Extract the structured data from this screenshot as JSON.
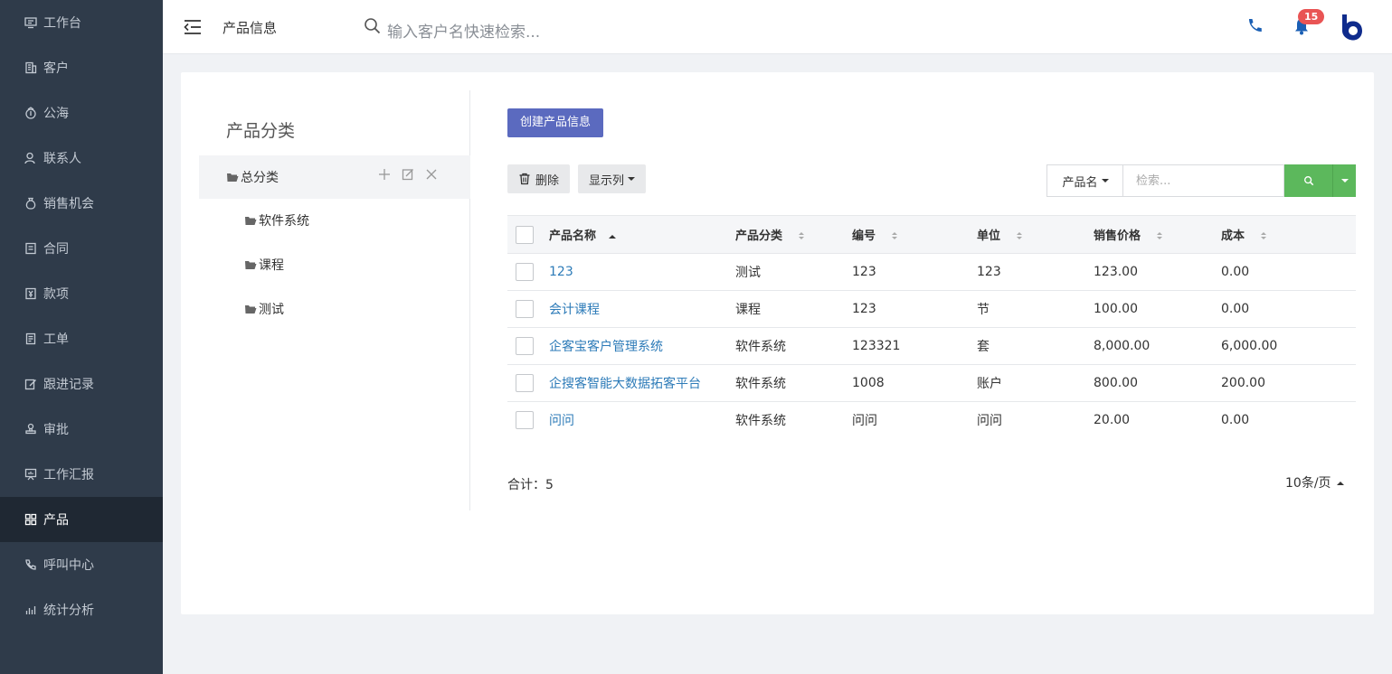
{
  "sidebar": {
    "items": [
      {
        "label": "工作台",
        "icon": "monitor-icon"
      },
      {
        "label": "客户",
        "icon": "building-icon"
      },
      {
        "label": "公海",
        "icon": "sea-icon"
      },
      {
        "label": "联系人",
        "icon": "contact-icon"
      },
      {
        "label": "销售机会",
        "icon": "money-bag-icon"
      },
      {
        "label": "合同",
        "icon": "contract-icon"
      },
      {
        "label": "款项",
        "icon": "payment-icon"
      },
      {
        "label": "工单",
        "icon": "ticket-icon"
      },
      {
        "label": "跟进记录",
        "icon": "edit-icon"
      },
      {
        "label": "审批",
        "icon": "stamp-icon"
      },
      {
        "label": "工作汇报",
        "icon": "report-icon"
      },
      {
        "label": "产品",
        "icon": "grid-icon",
        "active": true
      },
      {
        "label": "呼叫中心",
        "icon": "call-icon"
      },
      {
        "label": "统计分析",
        "icon": "chart-icon"
      }
    ]
  },
  "header": {
    "title": "产品信息",
    "search_placeholder": "输入客户名快速检索...",
    "notification_count": "15",
    "accent": "#1a5fb4"
  },
  "category": {
    "title": "产品分类",
    "root": "总分类",
    "children": [
      "软件系统",
      "课程",
      "测试"
    ]
  },
  "toolbar": {
    "create_label": "创建产品信息",
    "delete_label": "删除",
    "columns_label": "显示列",
    "filter_field": "产品名",
    "filter_placeholder": "检索..."
  },
  "table": {
    "headers": [
      "产品名称",
      "产品分类",
      "编号",
      "单位",
      "销售价格",
      "成本"
    ],
    "rows": [
      [
        "123",
        "测试",
        "123",
        "123",
        "123.00",
        "0.00"
      ],
      [
        "会计课程",
        "课程",
        "123",
        "节",
        "100.00",
        "0.00"
      ],
      [
        "企客宝客户管理系统",
        "软件系统",
        "123321",
        "套",
        "8,000.00",
        "6,000.00"
      ],
      [
        "企搜客智能大数据拓客平台",
        "软件系统",
        "1008",
        "账户",
        "800.00",
        "200.00"
      ],
      [
        "问问",
        "软件系统",
        "问问",
        "问问",
        "20.00",
        "0.00"
      ]
    ]
  },
  "footer": {
    "total_label": "合计：5",
    "page_size": "10条/页"
  }
}
